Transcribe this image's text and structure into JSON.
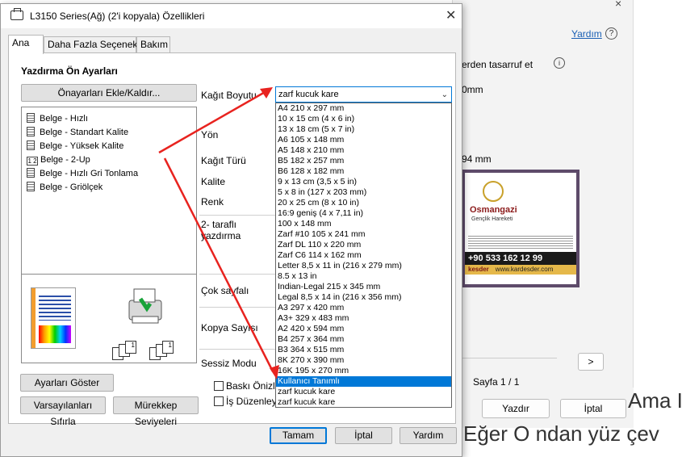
{
  "background": {
    "help_link": "Yardım",
    "help_q": "?",
    "save_text": "erden tasarruf et",
    "info_icon": "i",
    "size_text_1": "0mm",
    "size_text_2": "94 mm",
    "card_logo": "Osmangazi",
    "card_logo_sub": "Gençlik Hareketi",
    "card_phone": "+90 533 162 12 99",
    "card_brand": "kesder",
    "card_web": "www.kardesder.com",
    "next_label": ">",
    "page_label": "Sayfa 1 / 1",
    "print_label": "Yazdır",
    "cancel_label": "İptal",
    "text_line_1": "Ama I",
    "text_line_2": "Eğer O ndan yüz çev",
    "close_glyph": "×"
  },
  "dialog": {
    "title": "L3150 Series(Ağ) (2'i kopyala) Özellikleri",
    "close_glyph": "✕",
    "tabs": [
      "Ana",
      "Daha Fazla Seçenek",
      "Bakım"
    ],
    "presets_title": "Yazdırma Ön Ayarları",
    "add_remove_label": "Önayarları Ekle/Kaldır...",
    "presets": [
      "Belge - Hızlı",
      "Belge - Standart Kalite",
      "Belge - Yüksek Kalite",
      "Belge - 2-Up",
      "Belge - Hızlı Gri Tonlama",
      "Belge - Griölçek"
    ],
    "preset_2up_icon": "1 2",
    "copy_numbers": [
      "3",
      "2",
      "1"
    ],
    "show_settings_label": "Ayarları Göster",
    "reset_label": "Varsayılanları Sıfırla",
    "ink_label": "Mürekkep Seviyeleri",
    "labels": {
      "paper_size": "Kağıt Boyutu",
      "orientation": "Yön",
      "paper_type": "Kağıt Türü",
      "quality": "Kalite",
      "color": "Renk",
      "duplex_1": "2- taraflı",
      "duplex_2": "yazdırma",
      "multi_page": "Çok sayfalı",
      "copies": "Kopya Sayısı",
      "quiet_mode": "Sessiz Modu"
    },
    "paper_selected": "zarf kucuk kare",
    "chevron": "⌄",
    "paper_options": [
      "A4 210 x 297 mm",
      "10 x 15 cm (4 x 6 in)",
      "13 x 18 cm (5 x 7 in)",
      "A6 105 x 148 mm",
      "A5 148 x 210 mm",
      "B5 182 x 257 mm",
      "B6 128 x 182 mm",
      "9 x 13 cm (3,5 x 5 in)",
      "5 x 8 in (127 x 203 mm)",
      "20 x 25 cm (8 x 10 in)",
      "16:9 geniş (4 x 7,11 in)",
      "100 x 148 mm",
      "Zarf #10 105 x 241 mm",
      "Zarf DL  110 x 220 mm",
      "Zarf C6  114 x 162 mm",
      "Letter 8,5 x 11 in (216 x 279 mm)",
      "8.5 x 13 in",
      "Indian-Legal 215 x 345 mm",
      "Legal 8,5 x 14 in (216 x 356 mm)",
      "A3 297 x 420 mm",
      "A3+ 329 x 483 mm",
      "A2 420 x 594 mm",
      "B4 257 x 364 mm",
      "B3 364 x 515 mm",
      "8K 270 x 390 mm",
      "16K 195 x 270 mm",
      "Kullanıcı Tanımlı",
      "zarf kucuk karе",
      "zarf kucuk kare"
    ],
    "selected_index": 26,
    "chk_preview": "Baskı Önizleme",
    "chk_layout": "İş Düzenleyici",
    "ok_label": "Tamam",
    "cancel_label": "İptal",
    "help_label": "Yardım"
  },
  "colors": {
    "accent": "#0078d7",
    "annotation_arrow": "#e8231f"
  }
}
